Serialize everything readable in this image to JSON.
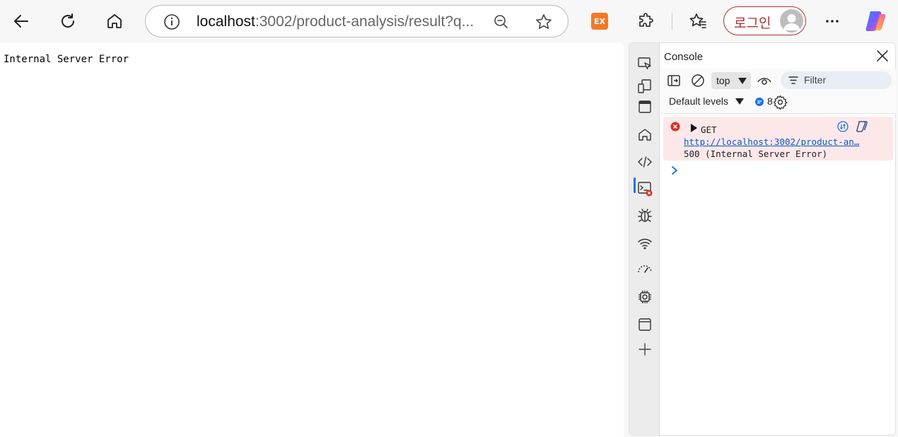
{
  "browser": {
    "url_host": "localhost",
    "url_rest": ":3002/product-analysis/result?q...",
    "extension_label": "EX",
    "login_label": "로그인"
  },
  "page": {
    "body_text": "Internal Server Error"
  },
  "devtools": {
    "panel_title": "Console",
    "context": "top",
    "filter_placeholder": "Filter",
    "levels_label": "Default levels",
    "message_count": "8",
    "error": {
      "method": "GET",
      "url": "http://localhost:3002/product-an…",
      "status": "500 (Internal Server Error)"
    }
  },
  "icons": [
    "back-icon",
    "reload-icon",
    "home-icon",
    "info-icon",
    "zoom-out-icon",
    "star-icon",
    "puzzle-icon",
    "favorites-icon",
    "more-icon",
    "copilot-icon",
    "inspect-icon",
    "device-icon",
    "panel-icon",
    "welcome-home-icon",
    "elements-icon",
    "console-icon",
    "sources-icon",
    "network-icon",
    "performance-icon",
    "memory-icon",
    "application-icon",
    "add-tool-icon",
    "close-icon",
    "sidebar-toggle-icon",
    "clear-icon",
    "eye-icon",
    "filter-icon",
    "gear-icon",
    "error-icon",
    "expand-triangle-icon",
    "ai-explain-icon",
    "copilot-small-icon",
    "prompt-chevron-icon"
  ],
  "colors": {
    "accent": "#1a73e8",
    "error": "#d93025",
    "login": "#b33030"
  }
}
